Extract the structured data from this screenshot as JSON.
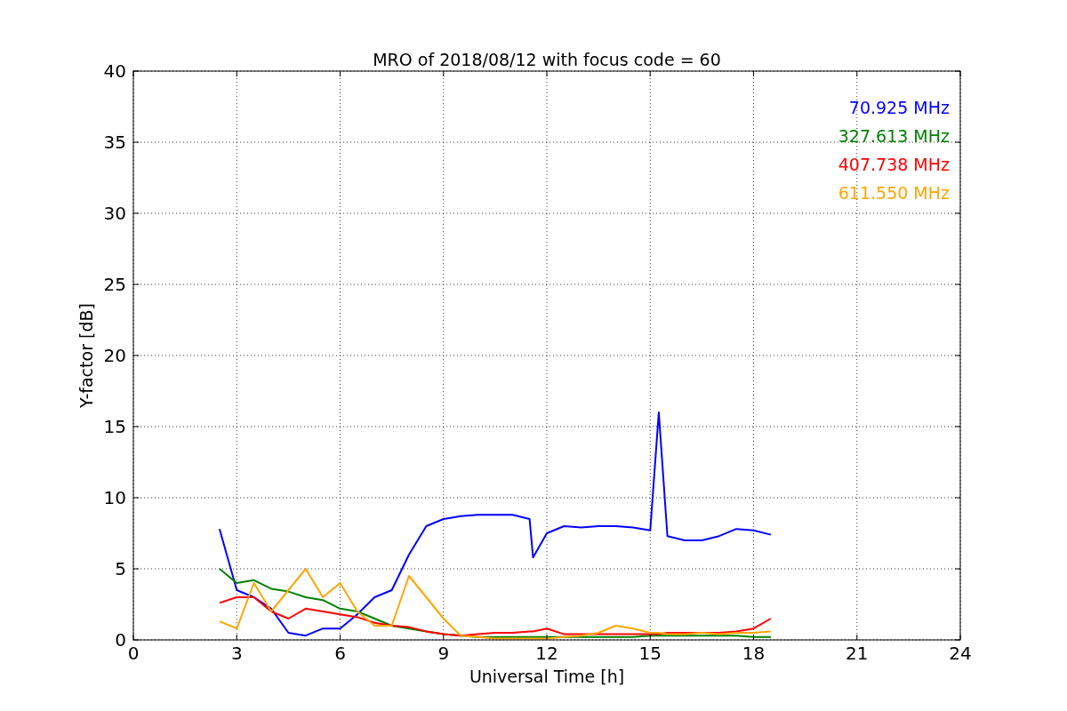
{
  "figure": {
    "chart_data": {
      "type": "line",
      "title": "MRO of 2018/08/12 with focus code = 60",
      "xlabel": "Universal Time [h]",
      "ylabel": "Y-factor [dB]",
      "x": [
        2.5,
        3,
        3.5,
        4,
        4.5,
        5,
        5.5,
        6,
        6.5,
        7,
        7.5,
        8,
        8.5,
        9,
        9.5,
        10,
        10.5,
        11,
        11.5,
        11.6,
        12,
        12.5,
        13,
        13.5,
        14,
        14.5,
        15,
        15.25,
        15.5,
        16,
        16.5,
        17,
        17.5,
        18,
        18.5
      ],
      "series": [
        {
          "name": "70.925 MHz",
          "color": "#0000ff",
          "values": [
            7.8,
            3.5,
            3.0,
            2.2,
            0.5,
            0.3,
            0.8,
            0.8,
            1.8,
            3.0,
            3.5,
            6.0,
            8.0,
            8.5,
            8.7,
            8.8,
            8.8,
            8.8,
            8.5,
            5.8,
            7.5,
            8.0,
            7.9,
            8.0,
            8.0,
            7.9,
            7.7,
            16.0,
            7.3,
            7.0,
            7.0,
            7.3,
            7.8,
            7.7,
            7.4
          ]
        },
        {
          "name": "327.613 MHz",
          "color": "#008000",
          "values": [
            5.0,
            4.0,
            4.2,
            3.6,
            3.4,
            3.0,
            2.8,
            2.2,
            2.0,
            1.5,
            1.0,
            0.8,
            0.6,
            0.4,
            0.3,
            0.2,
            0.2,
            0.2,
            0.2,
            0.2,
            0.2,
            0.2,
            0.2,
            0.2,
            0.2,
            0.2,
            0.3,
            0.3,
            0.3,
            0.3,
            0.3,
            0.3,
            0.3,
            0.2,
            0.2
          ]
        },
        {
          "name": "407.738 MHz",
          "color": "#ff0000",
          "values": [
            2.6,
            3.0,
            3.0,
            2.0,
            1.5,
            2.2,
            2.0,
            1.8,
            1.6,
            1.2,
            1.0,
            0.9,
            0.6,
            0.4,
            0.3,
            0.4,
            0.5,
            0.5,
            0.6,
            0.6,
            0.8,
            0.4,
            0.4,
            0.4,
            0.4,
            0.4,
            0.4,
            0.4,
            0.5,
            0.5,
            0.5,
            0.5,
            0.6,
            0.8,
            1.5
          ]
        },
        {
          "name": "611.550 MHz",
          "color": "#ffa500",
          "values": [
            1.3,
            0.8,
            4.0,
            2.0,
            3.5,
            5.0,
            3.0,
            4.0,
            2.0,
            1.0,
            1.0,
            4.5,
            3.0,
            1.5,
            0.3,
            0.2,
            0.1,
            0.1,
            0.1,
            0.1,
            0.1,
            0.2,
            0.3,
            0.5,
            1.0,
            0.8,
            0.5,
            0.5,
            0.4,
            0.4,
            0.5,
            0.4,
            0.5,
            0.5,
            0.6
          ]
        }
      ],
      "xlim": [
        0,
        24
      ],
      "ylim": [
        0,
        40
      ],
      "grid": true,
      "xticks": [
        0,
        3,
        6,
        9,
        12,
        15,
        18,
        21,
        24
      ],
      "yticks": [
        0,
        5,
        10,
        15,
        20,
        25,
        30,
        35,
        40
      ]
    }
  }
}
